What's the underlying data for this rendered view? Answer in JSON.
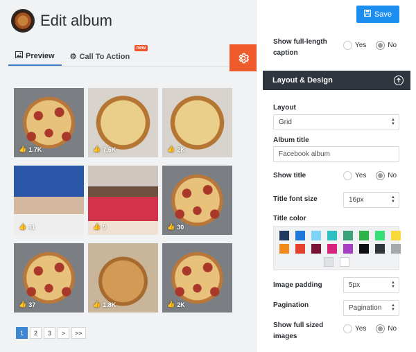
{
  "header": {
    "title": "Edit album"
  },
  "tabs": [
    {
      "label": "Preview",
      "icon": "image-icon"
    },
    {
      "label": "Call To Action",
      "icon": "cog-icon",
      "badge": "new"
    }
  ],
  "photos": [
    {
      "likes": "1.7K"
    },
    {
      "likes": "7.6K"
    },
    {
      "likes": "2K"
    },
    {
      "likes": "11"
    },
    {
      "likes": "9"
    },
    {
      "likes": "30"
    },
    {
      "likes": "37"
    },
    {
      "likes": "1.8K"
    },
    {
      "likes": "2K"
    }
  ],
  "pagination": [
    "1",
    "2",
    "3",
    ">",
    ">>"
  ],
  "sidebar": {
    "save_label": "Save",
    "show_caption_label": "Show full-length caption",
    "yes": "Yes",
    "no": "No",
    "section_title": "Layout & Design",
    "layout_label": "Layout",
    "layout_value": "Grid",
    "album_title_label": "Album title",
    "album_title_placeholder": "Facebook album",
    "show_title_label": "Show title",
    "title_font_size_label": "Title font size",
    "title_font_size_value": "16px",
    "title_color_label": "Title color",
    "image_padding_label": "Image padding",
    "image_padding_value": "5px",
    "pagination_label": "Pagination",
    "pagination_value": "Pagination",
    "show_full_images_label": "Show full sized images",
    "colors": [
      "#1f3a5c",
      "#1f77d8",
      "#7fd2f7",
      "#32bfc0",
      "#3aa17a",
      "#2fb24a",
      "#35e07a",
      "#f7d93a",
      "#f28a1a",
      "#e6412d",
      "#7c1235",
      "#d6237c",
      "#a83ec4",
      "#0d0d14",
      "#2e353b",
      "#a6a9ab",
      "#dfe1e3",
      "#ffffff"
    ]
  }
}
